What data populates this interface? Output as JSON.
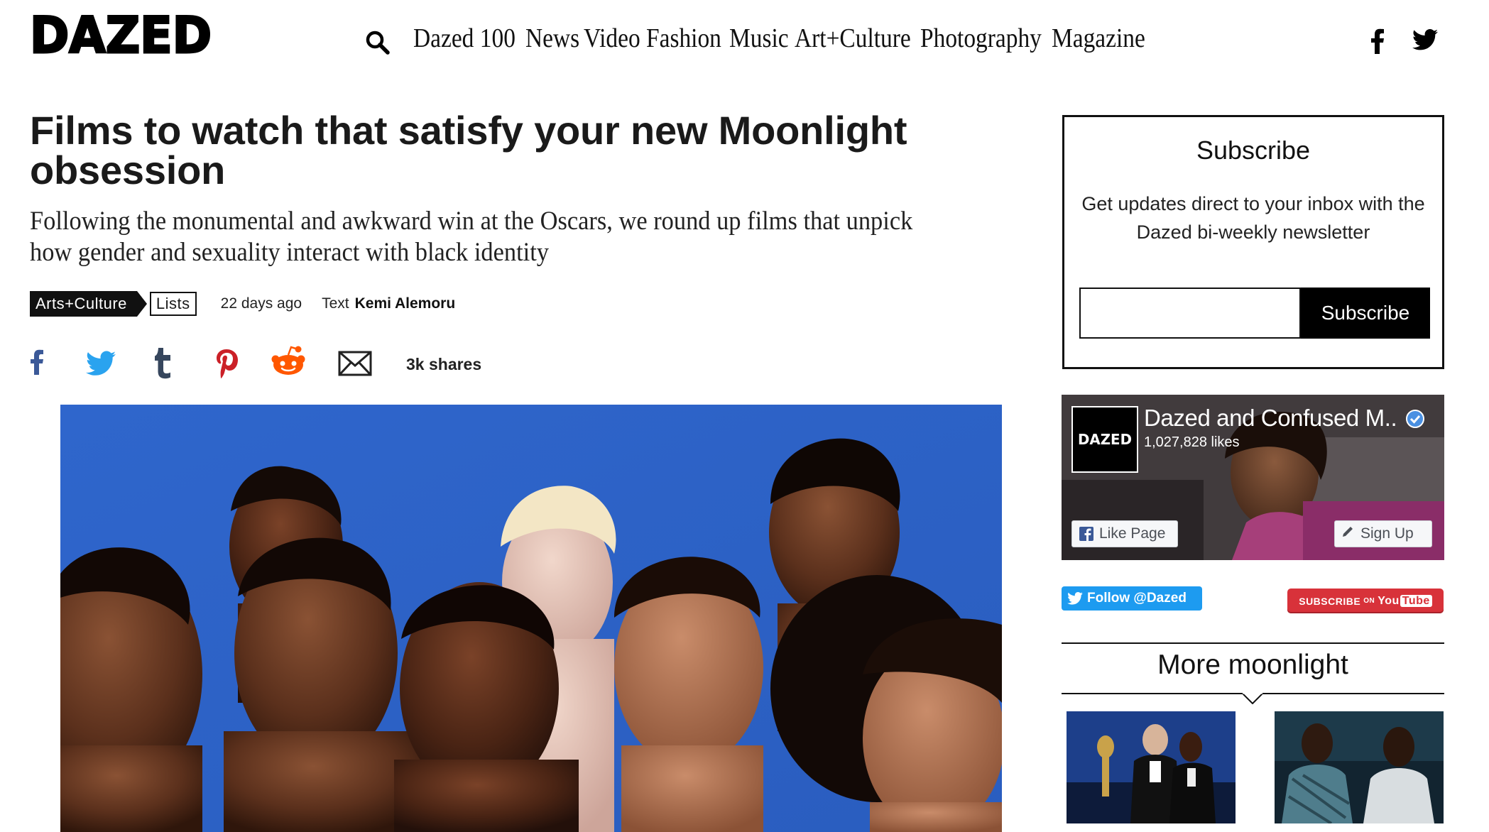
{
  "header": {
    "logo_text": "DAZED",
    "nav": [
      "Dazed 100",
      "News",
      "Video",
      "Fashion",
      "Music",
      "Art+Culture",
      "Photography",
      "Magazine"
    ]
  },
  "article": {
    "headline": "Films to watch that satisfy your new Moonlight obsession",
    "standfirst": "Following the monumental and awkward win at the Oscars, we round up films that unpick how gender and sexuality interact with black identity",
    "category_tag": "Arts+Culture",
    "format_tag": "Lists",
    "time_ago": "22 days ago",
    "byline_prefix": "Text",
    "author": "Kemi Alemoru",
    "shares": "3k shares",
    "share_icons": [
      "facebook-icon",
      "twitter-icon",
      "tumblr-icon",
      "pinterest-icon",
      "reddit-icon",
      "email-icon"
    ]
  },
  "sidebar": {
    "subscribe": {
      "title": "Subscribe",
      "text": "Get updates direct to your inbox with the Dazed bi-weekly newsletter",
      "input_value": "",
      "button_label": "Subscribe"
    },
    "facebook": {
      "logo_text": "DAZED",
      "page_name": "Dazed and Confused M..",
      "likes": "1,027,828 likes",
      "like_button": "Like Page",
      "signup_button": "Sign Up"
    },
    "twitter_follow": "Follow @Dazed",
    "youtube": {
      "subscribe": "SUBSCRIBE",
      "on": "ON",
      "you": "You",
      "tube": "Tube"
    },
    "more_title": "More moonlight"
  },
  "colors": {
    "hero_background": "#2c64c9",
    "facebook_blue": "#3b5998",
    "twitter_blue": "#1d9bf0",
    "pinterest_red": "#cb2027",
    "reddit_orange": "#ff5700",
    "youtube_red": "#d8323a"
  }
}
